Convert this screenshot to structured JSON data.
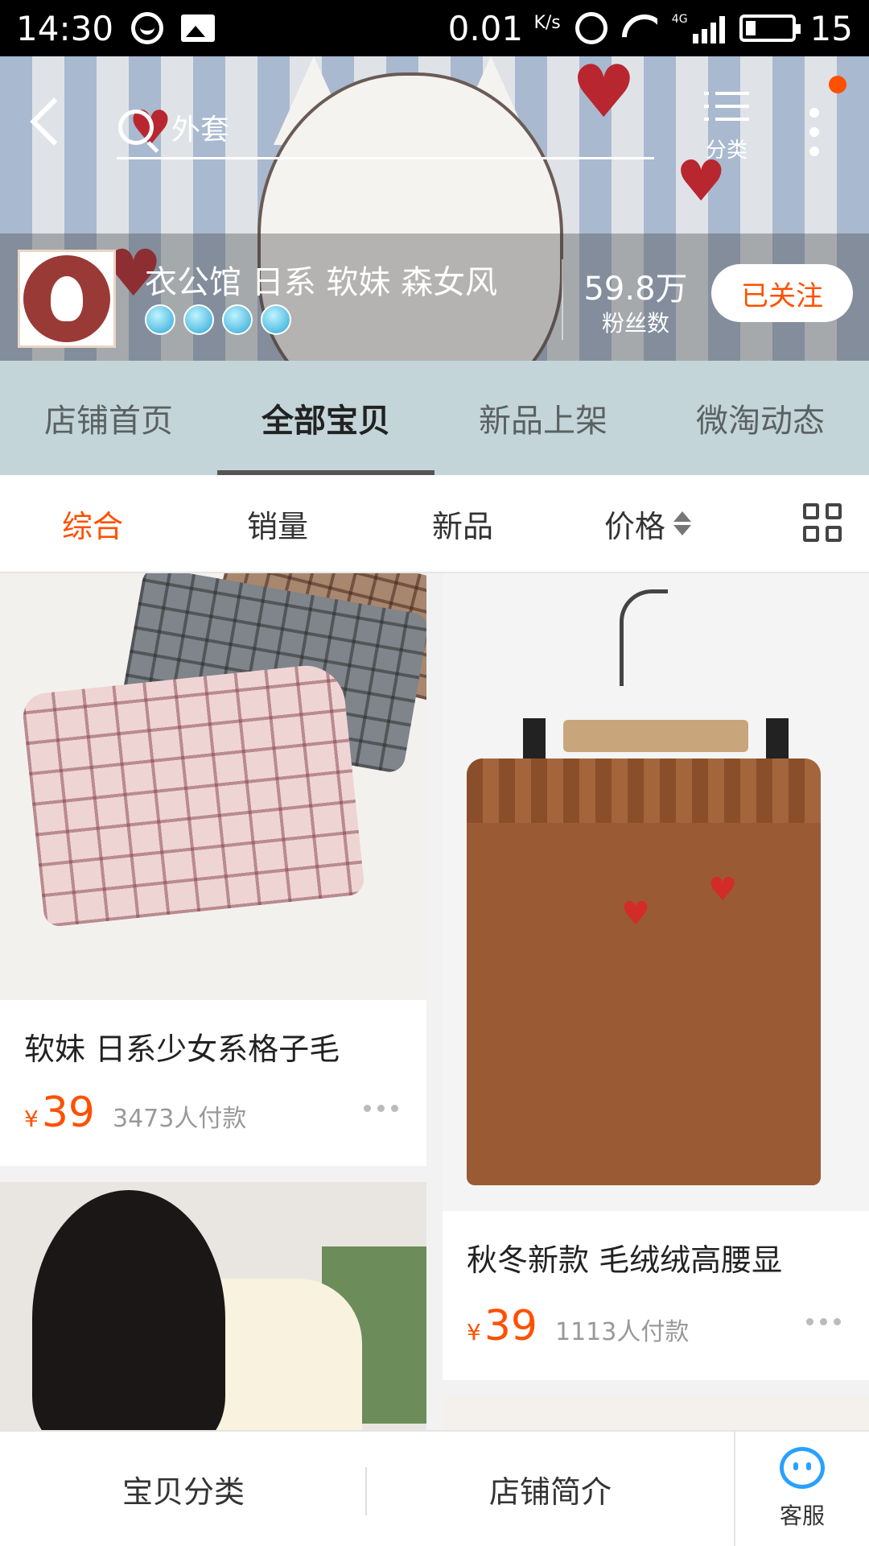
{
  "status_bar": {
    "time": "14:30",
    "net_speed": "0.01",
    "net_unit": "K/s",
    "network_type": "4G",
    "battery": "15",
    "icons": [
      "sync-icon",
      "image-notification-icon",
      "alarm-icon",
      "wifi-icon",
      "signal-icon",
      "battery-icon"
    ]
  },
  "header": {
    "search_text": "外套",
    "category_label": "分类"
  },
  "shop": {
    "name": "衣公馆 日系 软妹 森女风",
    "crown_count": 4,
    "fans_count": "59.8万",
    "fans_label": "粉丝数",
    "follow_label": "已关注"
  },
  "tabs": [
    {
      "label": "店铺首页",
      "active": false
    },
    {
      "label": "全部宝贝",
      "active": true
    },
    {
      "label": "新品上架",
      "active": false
    },
    {
      "label": "微淘动态",
      "active": false
    }
  ],
  "sort": {
    "items": [
      "综合",
      "销量",
      "新品",
      "价格"
    ],
    "active": "综合"
  },
  "products": [
    {
      "title": "软妹 日系少女系格子毛",
      "currency": "¥",
      "price": "39",
      "sold": "3473人付款"
    },
    {
      "title": "秋冬新款 毛绒绒高腰显",
      "currency": "¥",
      "price": "39",
      "sold": "1113人付款"
    }
  ],
  "bottom_bar": {
    "category": "宝贝分类",
    "intro": "店铺简介",
    "service": "客服"
  },
  "colors": {
    "accent": "#ff5000",
    "tab_bg": "#c3d5d8",
    "service_blue": "#29a1ff"
  }
}
